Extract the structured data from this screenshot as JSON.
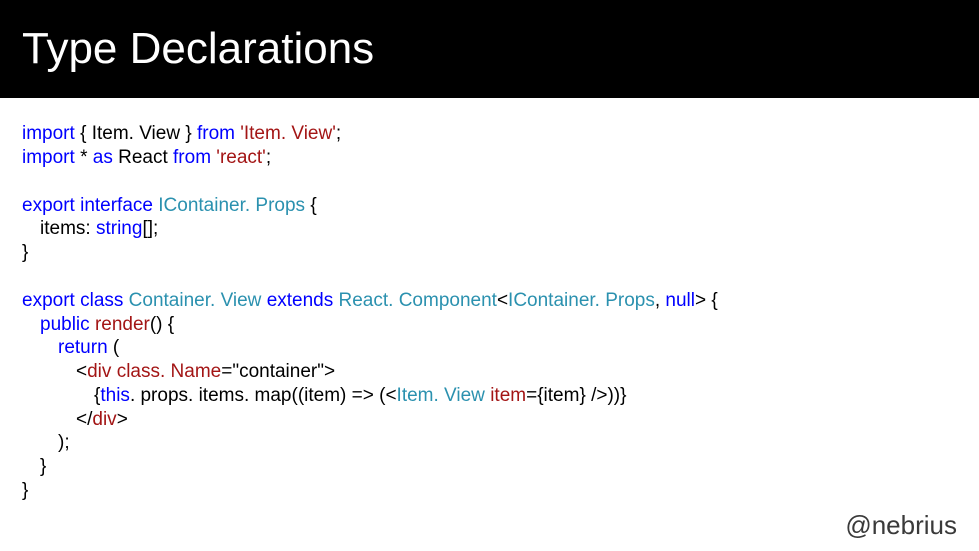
{
  "title": "Type Declarations",
  "code": {
    "l1_import": "import",
    "l1_brace_open": " { ",
    "l1_itemview": "Item. View",
    "l1_brace_close": " } ",
    "l1_from": "from",
    "l1_str": " 'Item. View'",
    "l1_semi": ";",
    "l2_import": "import",
    "l2_star": " * ",
    "l2_as": "as",
    "l2_react": " React ",
    "l2_from": "from",
    "l2_str": " 'react'",
    "l2_semi": ";",
    "l3_export": "export",
    "l3_sp": " ",
    "l3_interface": "interface",
    "l3_sp2": " ",
    "l3_name": "IContainer. Props",
    "l3_brace": " {",
    "l4_items": "items",
    "l4_colon": ": ",
    "l4_type": "string",
    "l4_arr": "[];",
    "l5_close": "}",
    "l6_export": "export",
    "l6_sp": " ",
    "l6_class": "class",
    "l6_sp2": " ",
    "l6_name": "Container. View",
    "l6_sp3": " ",
    "l6_extends": "extends",
    "l6_sp4": " ",
    "l6_react": "React. Component",
    "l6_lt": "<",
    "l6_prop": "IContainer. Props",
    "l6_comma": ", ",
    "l6_null": "null",
    "l6_gt": "> {",
    "l7_public": "public",
    "l7_sp": " ",
    "l7_render": "render",
    "l7_paren": "() {",
    "l8_return": "return",
    "l8_paren": " (",
    "l9_lt": "<",
    "l9_div": "div",
    "l9_sp": " ",
    "l9_attr": "class. Name",
    "l9_eq": "=",
    "l9_val": "\"container\"",
    "l9_gt": ">",
    "l10_open": "{",
    "l10_this": "this",
    "l10_chain": ". props. items. map((item) => (<",
    "l10_comp": "Item. View",
    "l10_sp": " ",
    "l10_prop": "item",
    "l10_eq": "=",
    "l10_val_open": "{item}",
    "l10_sp2": " ",
    "l10_close": "/>))}",
    "l11_lt": "<",
    "l11_slash": "/",
    "l11_div": "div",
    "l11_gt": ">",
    "l12_close": ");",
    "l13_close": "}",
    "l14_close": "}"
  },
  "footer": "@nebrius"
}
